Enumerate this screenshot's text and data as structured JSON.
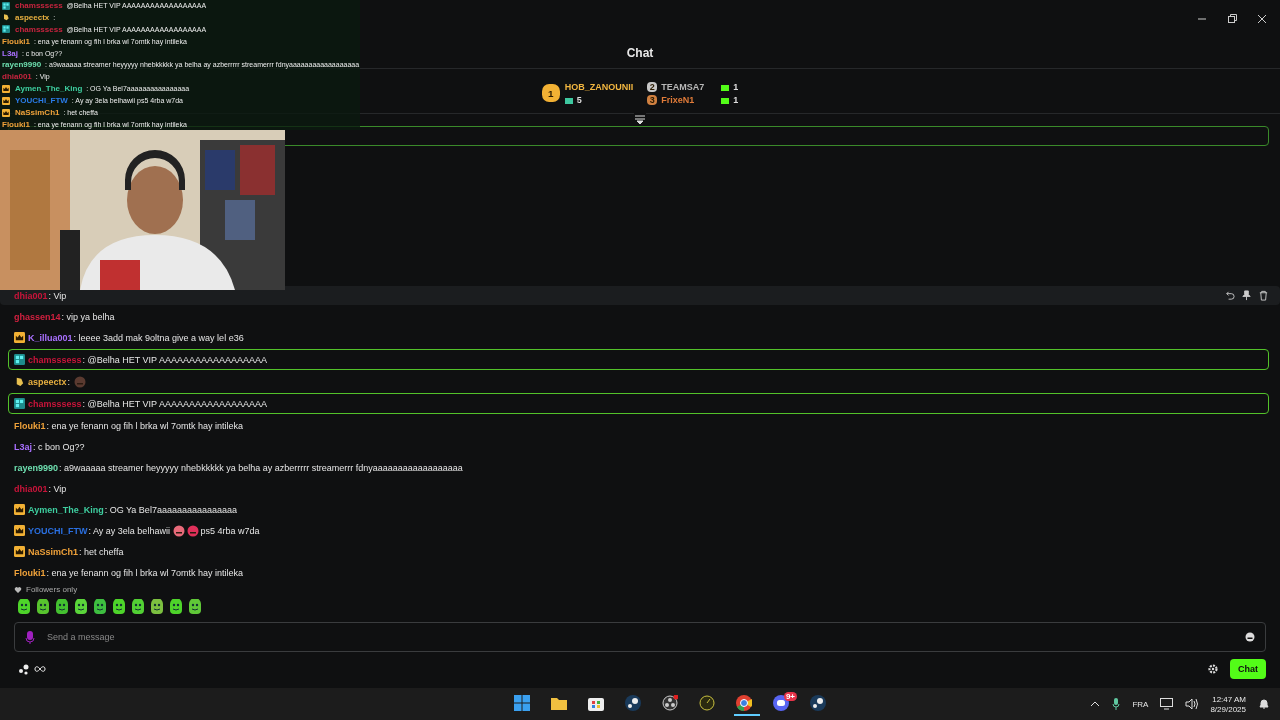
{
  "overlay_chat": [
    {
      "user": "chamsssess",
      "text": "@Belha HET VIP AAAAAAAAAAAAAAAAAA",
      "color": "#c8243f",
      "kind": "og"
    },
    {
      "user": "aspeectx",
      "text": ":",
      "color": "#e8b040",
      "kind": "hand"
    },
    {
      "user": "chamsssess",
      "text": "@Belha HET VIP AAAAAAAAAAAAAAAAAA",
      "color": "#c8243f",
      "kind": "og"
    },
    {
      "user": "Flouki1",
      "text": ": ena ye fenann og fih l brka wl 7omtk hay intileka",
      "color": "#f0a23a",
      "kind": "plain"
    },
    {
      "user": "L3aj",
      "text": ": c bon Og??",
      "color": "#a970ff",
      "kind": "plain"
    },
    {
      "user": "rayen9990",
      "text": ": a9waaaaa streamer heyyyyy nhebkkkkk ya belha ay azberrrrr streamerrr fdnyaaaaaaaaaaaaaaaaaa",
      "color": "#6ee0b0",
      "kind": "plain"
    },
    {
      "user": "dhia001",
      "text": ": Vip",
      "color": "#c8243f",
      "kind": "plain"
    },
    {
      "user": "Aymen_The_King",
      "text": ": OG Ya Bel7aaaaaaaaaaaaaaaa",
      "color": "#3ecfa0",
      "kind": "crown"
    },
    {
      "user": "YOUCHI_FTW",
      "text": ": Ay ay 3ela belhawii ps5 4rba w7da",
      "color": "#2a7be8",
      "kind": "crown"
    },
    {
      "user": "NaSsimCh1",
      "text": ": het cheffa",
      "color": "#f0a23a",
      "kind": "crown"
    },
    {
      "user": "Flouki1",
      "text": ": ena ye fenann og fih l brka wl 7omtk hay intileka",
      "color": "#f0a23a",
      "kind": "plain"
    }
  ],
  "header": {
    "title": "Chat"
  },
  "leaderboard": [
    {
      "rank": "1",
      "name": "HOB_ZANOUNII",
      "count": "5",
      "color": "#f2b640"
    },
    {
      "rank": "2",
      "name": "TEAMSA7",
      "count": "1",
      "color": "#b8b8b8"
    },
    {
      "rank": "3",
      "name": "FrixeN1",
      "count": "1",
      "color": "#e07b39"
    }
  ],
  "messages": [
    {
      "user": "dhia001",
      "color": "#c8143a",
      "kind": "plain",
      "highlighted": false,
      "hovered": true,
      "parts": [
        {
          "kind": "text",
          "text": ": Vip"
        }
      ]
    },
    {
      "user": "ghassen14",
      "color": "#d0203f",
      "kind": "plain",
      "highlighted": false,
      "hovered": false,
      "parts": [
        {
          "kind": "text",
          "text": ": vip ya belha"
        }
      ]
    },
    {
      "user": "K_illua001",
      "color": "#a970ff",
      "kind": "crown",
      "highlighted": false,
      "hovered": false,
      "parts": [
        {
          "kind": "text",
          "text": ": leeee 3add mak 9oltna give a way lel e36"
        }
      ]
    },
    {
      "user": "chamsssess",
      "color": "#c8143a",
      "kind": "og",
      "highlighted": true,
      "hovered": false,
      "parts": [
        {
          "kind": "text",
          "text": ": @Belha HET VIP AAAAAAAAAAAAAAAAAA"
        }
      ]
    },
    {
      "user": "aspeectx",
      "color": "#e8b040",
      "kind": "hand",
      "highlighted": false,
      "hovered": false,
      "parts": [
        {
          "kind": "text",
          "text": ":"
        },
        {
          "kind": "emote",
          "color": "#5a3a30"
        }
      ]
    },
    {
      "user": "chamsssess",
      "color": "#c8143a",
      "kind": "og",
      "highlighted": true,
      "hovered": false,
      "parts": [
        {
          "kind": "text",
          "text": ": @Belha HET VIP AAAAAAAAAAAAAAAAAA"
        }
      ]
    },
    {
      "user": "Flouki1",
      "color": "#f0a23a",
      "kind": "plain",
      "highlighted": false,
      "hovered": false,
      "parts": [
        {
          "kind": "text",
          "text": ": ena ye fenann og fih l brka wl 7omtk hay intileka"
        }
      ]
    },
    {
      "user": "L3aj",
      "color": "#a970ff",
      "kind": "plain",
      "highlighted": false,
      "hovered": false,
      "parts": [
        {
          "kind": "text",
          "text": ": c bon Og??"
        }
      ]
    },
    {
      "user": "rayen9990",
      "color": "#6ee0b0",
      "kind": "plain",
      "highlighted": false,
      "hovered": false,
      "parts": [
        {
          "kind": "text",
          "text": ": a9waaaaa streamer heyyyyy nhebkkkkk ya belha ay azberrrrr streamerrr fdnyaaaaaaaaaaaaaaaaaa"
        }
      ]
    },
    {
      "user": "dhia001",
      "color": "#c8143a",
      "kind": "plain",
      "highlighted": false,
      "hovered": false,
      "parts": [
        {
          "kind": "text",
          "text": ": Vip"
        }
      ]
    },
    {
      "user": "Aymen_The_King",
      "color": "#3ecfa0",
      "kind": "crown",
      "highlighted": false,
      "hovered": false,
      "parts": [
        {
          "kind": "text",
          "text": ": OG Ya Bel7aaaaaaaaaaaaaaaa"
        }
      ]
    },
    {
      "user": "YOUCHI_FTW",
      "color": "#2a6fe0",
      "kind": "crown",
      "highlighted": false,
      "hovered": false,
      "parts": [
        {
          "kind": "text",
          "text": ": Ay ay 3ela belhawii"
        },
        {
          "kind": "emote",
          "color": "#e86a7a"
        },
        {
          "kind": "emote",
          "color": "#e0305a"
        },
        {
          "kind": "text",
          "text": "ps5 4rba w7da"
        }
      ]
    },
    {
      "user": "NaSsimCh1",
      "color": "#f0a23a",
      "kind": "crown",
      "highlighted": false,
      "hovered": false,
      "parts": [
        {
          "kind": "text",
          "text": ": het cheffa"
        }
      ]
    },
    {
      "user": "Flouki1",
      "color": "#f0a23a",
      "kind": "plain",
      "highlighted": false,
      "hovered": false,
      "parts": [
        {
          "kind": "text",
          "text": ": ena ye fenann og fih l brka wl 7omtk hay intileka"
        }
      ]
    }
  ],
  "chat_mode": "Followers only",
  "input": {
    "placeholder": "Send a message"
  },
  "send_button": "Chat",
  "taskbar": {
    "discord_badge": "9+",
    "language": "FRA",
    "time": "12:47 AM",
    "date": "8/29/2025"
  }
}
